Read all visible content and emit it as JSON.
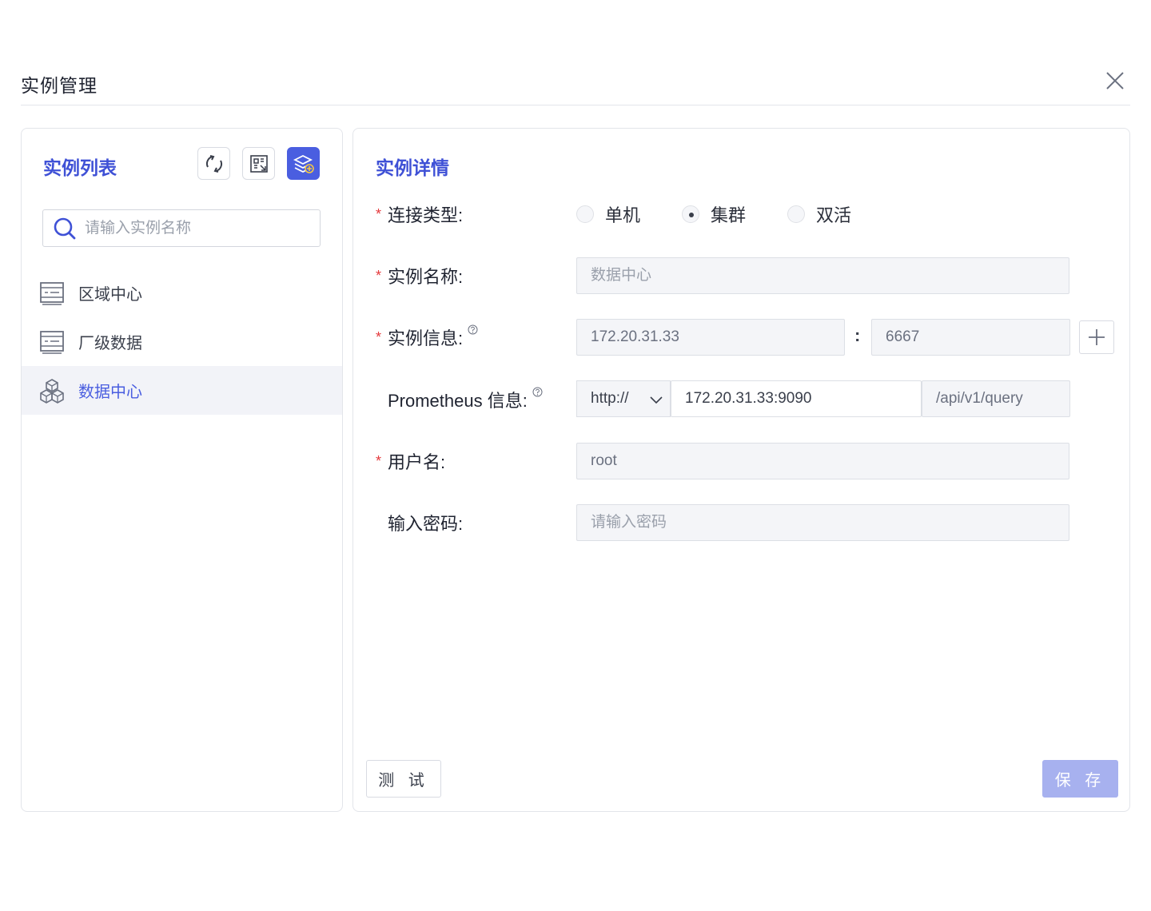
{
  "dialog": {
    "title": "实例管理",
    "close_icon": "close-icon"
  },
  "instance_list": {
    "title": "实例列表",
    "tools": [
      {
        "name": "refresh-icon"
      },
      {
        "name": "scan-icon"
      },
      {
        "name": "add-layers-icon"
      }
    ],
    "search": {
      "placeholder": "请输入实例名称",
      "value": ""
    },
    "items": [
      {
        "label": "区域中心",
        "icon": "server-icon",
        "active": false
      },
      {
        "label": "厂级数据",
        "icon": "server-icon",
        "active": false
      },
      {
        "label": "数据中心",
        "icon": "cluster-cubes-icon",
        "active": true
      }
    ]
  },
  "instance_detail": {
    "title": "实例详情",
    "connection_type": {
      "label": "连接类型:",
      "options": [
        "单机",
        "集群",
        "双活"
      ],
      "selected": "集群"
    },
    "instance_name": {
      "label": "实例名称:",
      "value": "",
      "placeholder": "数据中心"
    },
    "instance_info": {
      "label": "实例信息:",
      "host": "172.20.31.33",
      "separator": ":",
      "port": "6667"
    },
    "prometheus": {
      "label": "Prometheus 信息:",
      "protocol": "http://",
      "address": "172.20.31.33:9090",
      "path": "/api/v1/query"
    },
    "username": {
      "label": "用户名:",
      "value": "root"
    },
    "password": {
      "label": "输入密码:",
      "value": "",
      "placeholder": "请输入密码"
    },
    "test_label": "测 试",
    "save_label": "保 存"
  },
  "colors": {
    "accent": "#4a5ee0",
    "title_blue": "#3f51d6",
    "save_disabled": "#a7b1ef",
    "required": "#e4393c",
    "field_bg": "#f4f5f8"
  }
}
